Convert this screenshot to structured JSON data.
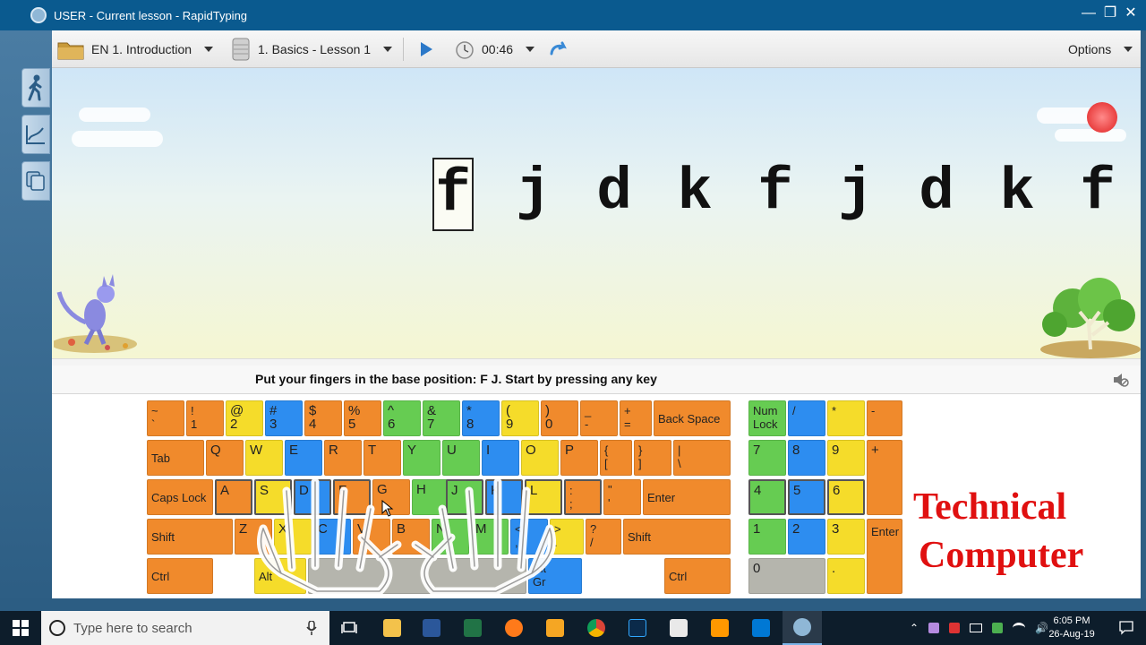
{
  "window": {
    "title": "USER - Current lesson - RapidTyping"
  },
  "toolbar": {
    "course": "EN 1. Introduction",
    "lesson": "1. Basics - Lesson 1",
    "timer": "00:46",
    "options": "Options"
  },
  "lesson": {
    "letters": [
      "f",
      "j",
      "d",
      "k",
      "f",
      "j",
      "d",
      "k",
      "f"
    ],
    "current_index": 0,
    "instruction": "Put your fingers in the base position:  F J.  Start by pressing any key"
  },
  "keyboard": {
    "row1": [
      "~\n`",
      "!\n1",
      "@\n2",
      "#\n3",
      "$\n4",
      "%\n5",
      "^\n6",
      "&\n7",
      "*\n8",
      "(\n9",
      ")\n0",
      "_\n-",
      "+\n=",
      "Back Space"
    ],
    "row2": [
      "Tab",
      "Q",
      "W",
      "E",
      "R",
      "T",
      "Y",
      "U",
      "I",
      "O",
      "P",
      "{\n[",
      "}\n]",
      "|\n\\"
    ],
    "row3": [
      "Caps Lock",
      "A",
      "S",
      "D",
      "F",
      "G",
      "H",
      "J",
      "K",
      "L",
      ":\n;",
      "\"\n'",
      "Enter"
    ],
    "row4": [
      "Shift",
      "Z",
      "X",
      "C",
      "V",
      "B",
      "N",
      "M",
      "<\n,",
      ">\n.",
      "?\n/",
      "Shift"
    ],
    "row5": [
      "Ctrl",
      "Alt",
      "",
      "Alt\nGr",
      "Ctrl"
    ],
    "numpad": {
      "r1": [
        "Num\nLock",
        "/",
        "*",
        "-"
      ],
      "r2": [
        "7",
        "8",
        "9",
        "+"
      ],
      "r3": [
        "4",
        "5",
        "6"
      ],
      "r4": [
        "1",
        "2",
        "3",
        "Enter"
      ],
      "r5": [
        "0",
        "."
      ]
    }
  },
  "watermark": {
    "line1": "Technical",
    "line2": "Computer"
  },
  "taskbar": {
    "search_placeholder": "Type here to search",
    "time": "6:05 PM",
    "date": "26-Aug-19"
  },
  "colors": {
    "orange": "#f08a2c",
    "yellow": "#f5dc2a",
    "blue": "#2d8df0",
    "green": "#66cc52",
    "gray": "#b5b5ad",
    "watermark": "#e01010"
  }
}
